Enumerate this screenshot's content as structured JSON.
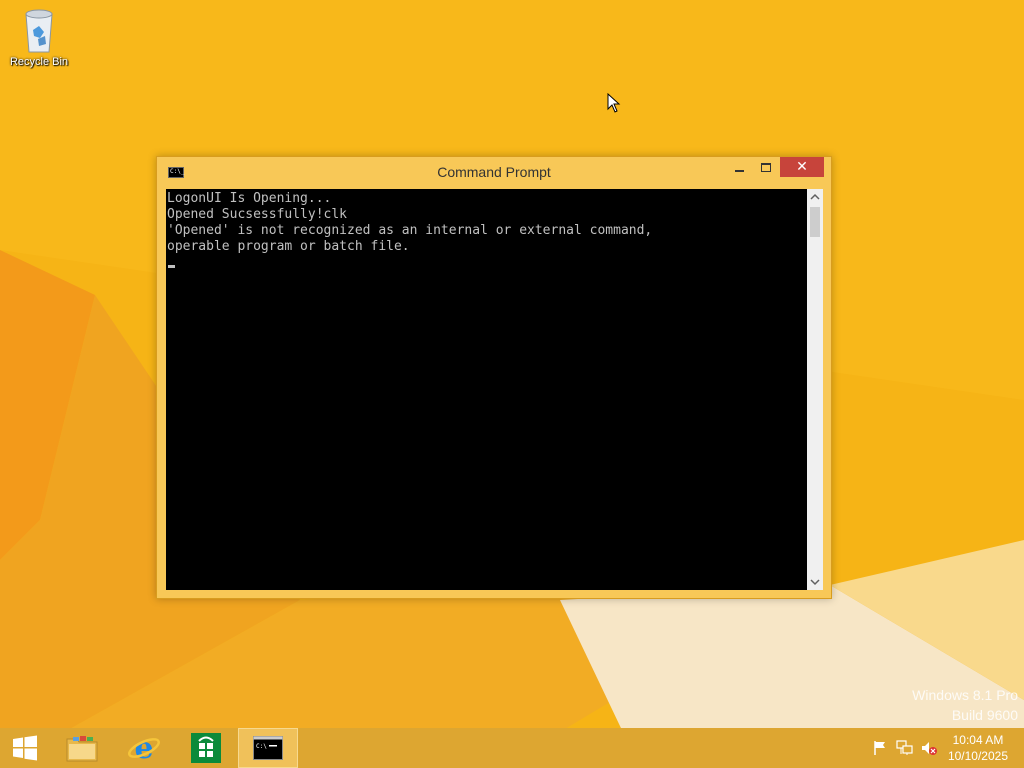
{
  "desktop": {
    "icons": [
      {
        "label": "Recycle Bin",
        "icon": "recycle-bin-icon"
      }
    ],
    "watermark": {
      "line1": "Windows 8.1 Pro",
      "line2": "Build 9600"
    }
  },
  "window": {
    "title": "Command Prompt",
    "icon": "cmd-icon",
    "controls": {
      "minimize": "minimize",
      "maximize": "maximize",
      "close": "✕"
    },
    "console_lines": [
      "LogonUI Is Opening...",
      "Opened Sucsessfully!clk",
      "'Opened' is not recognized as an internal or external command,",
      "operable program or batch file."
    ]
  },
  "taskbar": {
    "buttons": [
      {
        "name": "start",
        "icon": "windows-logo-icon"
      },
      {
        "name": "file-explorer",
        "icon": "folder-icon"
      },
      {
        "name": "internet-explorer",
        "icon": "ie-icon"
      },
      {
        "name": "store",
        "icon": "store-icon"
      },
      {
        "name": "command-prompt",
        "icon": "cmd-icon",
        "active": true
      }
    ],
    "tray": {
      "icons": [
        "flag-icon",
        "network-icon",
        "volume-muted-icon"
      ],
      "time": "10:04 AM",
      "date": "10/10/2025"
    }
  },
  "colors": {
    "desktop_background": "#f6b416",
    "window_frame": "#f8c857",
    "close_button": "#c7443b",
    "taskbar": "#dda631",
    "console_background": "#000000",
    "console_text": "#c0c0c0"
  }
}
